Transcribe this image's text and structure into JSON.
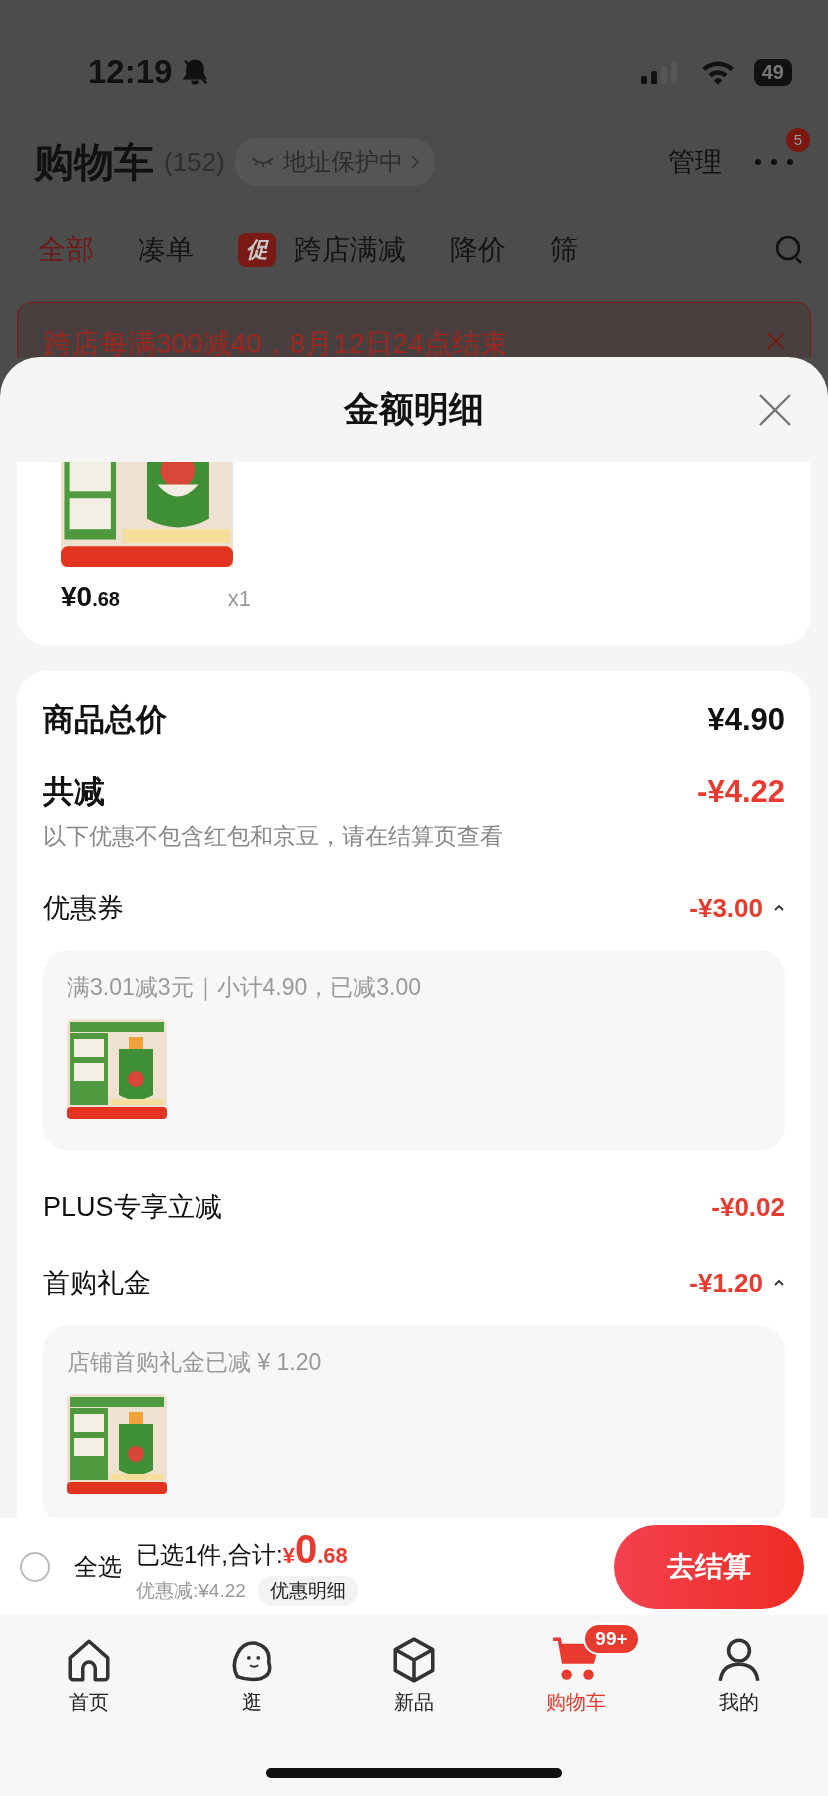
{
  "status_bar": {
    "time": "12:19",
    "battery": "49"
  },
  "header": {
    "title": "购物车",
    "count": "(152)",
    "address_chip": "地址保护中",
    "manage": "管理",
    "more_badge": "5"
  },
  "tabs": [
    {
      "label": "全部",
      "selected": true
    },
    {
      "label": "凑单",
      "selected": false
    },
    {
      "label": "跨店满减",
      "selected": false,
      "badge": "促"
    },
    {
      "label": "降价",
      "selected": false
    },
    {
      "label": "筛",
      "selected": false
    }
  ],
  "banner": {
    "text": "跨店每满300减40，8月12日24点结束"
  },
  "sheet": {
    "title": "金额明细",
    "product": {
      "kind": "picture",
      "price_main": "¥0",
      "price_cents": ".68",
      "quantity": "x1"
    },
    "total": {
      "label": "商品总价",
      "value": "¥4.90"
    },
    "reduction": {
      "label": "共减",
      "value": "-¥4.22",
      "note": "以下优惠不包含红包和京豆，请在结算页查看"
    },
    "lines": [
      {
        "kind": "group",
        "label": "优惠券",
        "value": "-¥3.00",
        "expanded": true,
        "detail": "满3.01减3元｜小计4.90，已减3.00"
      },
      {
        "kind": "plain",
        "label": "PLUS专享立减",
        "value": "-¥0.02"
      },
      {
        "kind": "group",
        "label": "首购礼金",
        "value": "-¥1.20",
        "expanded": true,
        "detail": "店铺首购礼金已减 ¥ 1.20"
      }
    ]
  },
  "checkout": {
    "select_all": "全选",
    "checked": false,
    "selected_text": "已选1件,合计:",
    "currency": "¥",
    "amount_main": "0",
    "amount_cents": ".68",
    "discount": "优惠减:¥4.22",
    "detail_button": "优惠明细",
    "button": "去结算"
  },
  "tabbar": [
    {
      "kind": "home",
      "label": "首页",
      "selected": false
    },
    {
      "kind": "browse",
      "label": "逛",
      "selected": false
    },
    {
      "kind": "new",
      "label": "新品",
      "selected": false
    },
    {
      "kind": "cart",
      "label": "购物车",
      "selected": true,
      "badge": "99+"
    },
    {
      "kind": "me",
      "label": "我的",
      "selected": false
    }
  ]
}
